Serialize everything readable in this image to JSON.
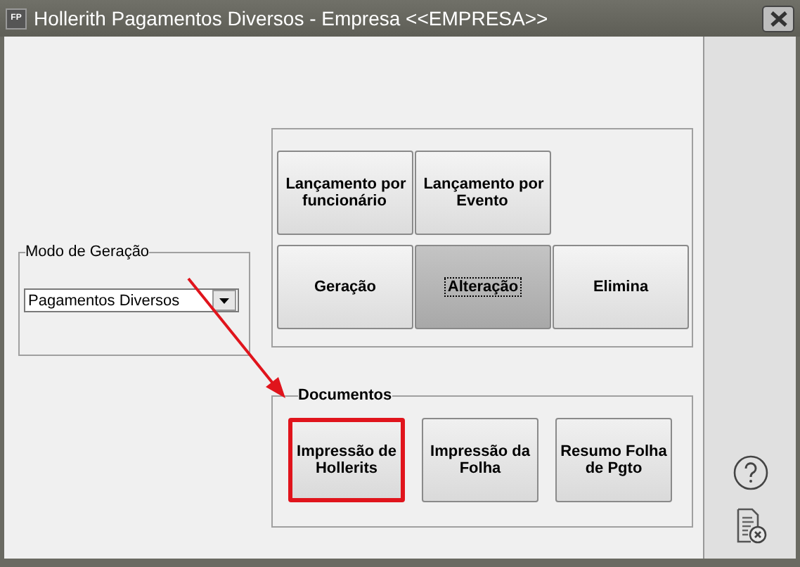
{
  "window": {
    "icon_label": "FP",
    "title": "Hollerith Pagamentos Diversos - Empresa <<EMPRESA>>"
  },
  "mode_group": {
    "legend": "Modo de Geração",
    "select_value": "Pagamentos Diversos"
  },
  "actions": [
    {
      "label": "Lançamento por funcionário",
      "selected": false
    },
    {
      "label": "Lançamento por Evento",
      "selected": false
    },
    {
      "label": "Geração",
      "selected": false
    },
    {
      "label": "Alteração",
      "selected": true
    },
    {
      "label": "Elimina",
      "selected": false
    }
  ],
  "documents": {
    "legend": "Documentos",
    "buttons": [
      {
        "label": "Impressão de Hollerits",
        "highlighted": true
      },
      {
        "label": "Impressão da Folha",
        "highlighted": false
      },
      {
        "label": "Resumo Folha de Pgto",
        "highlighted": false
      }
    ]
  }
}
